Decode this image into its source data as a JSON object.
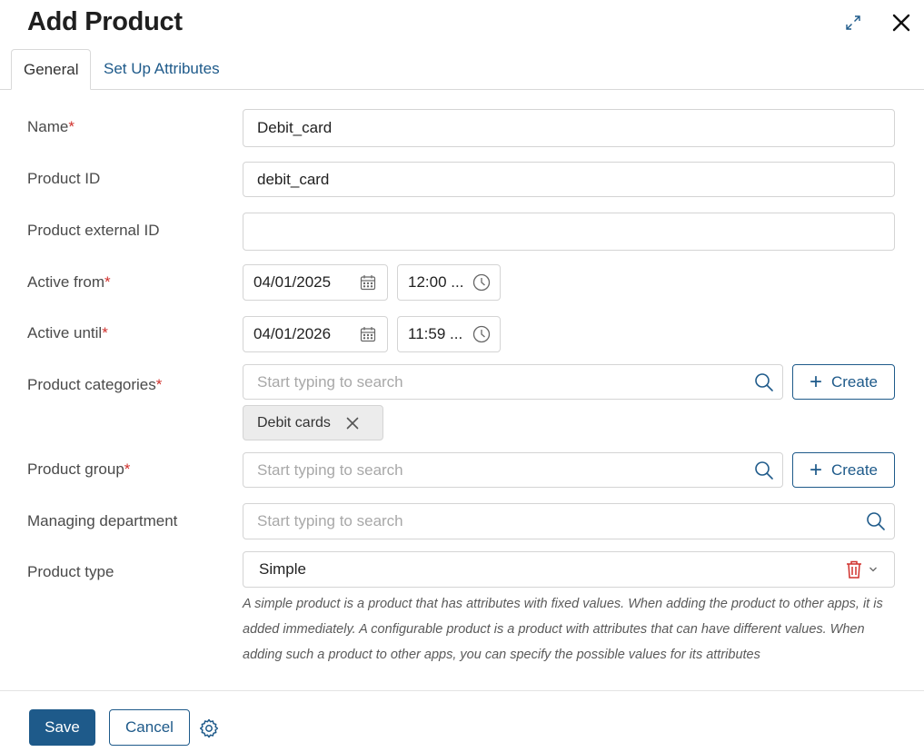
{
  "dialog": {
    "title": "Add Product"
  },
  "tabs": [
    {
      "label": "General",
      "active": true
    },
    {
      "label": "Set Up Attributes",
      "active": false
    }
  ],
  "form": {
    "required_marker": "*",
    "name": {
      "label": "Name",
      "value": "Debit_card",
      "required": true
    },
    "product_id": {
      "label": "Product ID",
      "value": "debit_card"
    },
    "external_id": {
      "label": "Product external ID",
      "value": ""
    },
    "active_from": {
      "label": "Active from",
      "date": "04/01/2025",
      "time": "12:00 ...",
      "required": true
    },
    "active_until": {
      "label": "Active until",
      "date": "04/01/2026",
      "time": "11:59 ...",
      "required": true
    },
    "categories": {
      "label": "Product categories",
      "placeholder": "Start typing to search",
      "create_label": "Create",
      "selected": [
        "Debit cards"
      ],
      "required": true
    },
    "group": {
      "label": "Product group",
      "placeholder": "Start typing to search",
      "create_label": "Create",
      "required": true
    },
    "department": {
      "label": "Managing department",
      "placeholder": "Start typing to search"
    },
    "type": {
      "label": "Product type",
      "value": "Simple",
      "hint": "A simple product is a product that has attributes with fixed values. When adding the product to other apps, it is added immediately. A configurable product is a product with attributes that can have different values. When adding such a product to other apps, you can specify the possible values for its attributes"
    }
  },
  "footer": {
    "save_label": "Save",
    "cancel_label": "Cancel"
  },
  "colors": {
    "primary": "#1e5a8a",
    "required": "#d0302c",
    "delete": "#d0302c"
  }
}
